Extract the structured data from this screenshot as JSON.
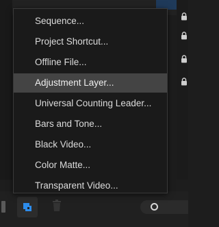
{
  "colors": {
    "menu_bg": "#1a1a1a",
    "menu_highlight": "#444444",
    "menu_text": "#dcdcdc",
    "accent_blue": "#2d8ceb"
  },
  "context_menu": {
    "items": [
      {
        "label": "Sequence...",
        "highlighted": false
      },
      {
        "label": "Project Shortcut...",
        "highlighted": false
      },
      {
        "label": "Offline File...",
        "highlighted": false
      },
      {
        "label": "Adjustment Layer...",
        "highlighted": true
      },
      {
        "label": "Universal Counting Leader...",
        "highlighted": false
      },
      {
        "label": "Bars and Tone...",
        "highlighted": false
      },
      {
        "label": "Black Video...",
        "highlighted": false
      },
      {
        "label": "Color Matte...",
        "highlighted": false
      },
      {
        "label": "Transparent Video...",
        "highlighted": false
      }
    ]
  },
  "toolbar": {
    "new_item_icon": "new-item-icon",
    "trash_icon": "trash-icon",
    "zoom_slider_icon": "zoom-slider-knob"
  }
}
